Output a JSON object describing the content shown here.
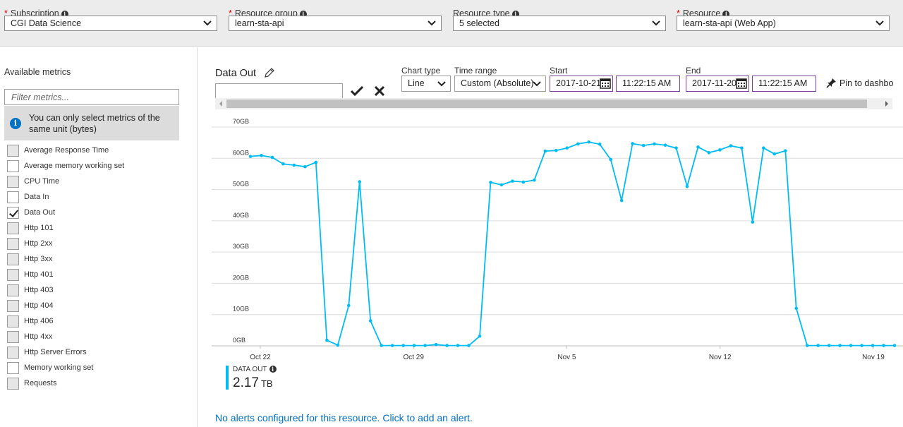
{
  "filters": {
    "subscription": {
      "label": "Subscription",
      "required": true,
      "value": "CGI Data Science"
    },
    "resource_group": {
      "label": "Resource group",
      "required": true,
      "value": "learn-sta-api"
    },
    "resource_type": {
      "label": "Resource type",
      "required": false,
      "value": "5 selected"
    },
    "resource": {
      "label": "Resource",
      "required": true,
      "value": "learn-sta-api (Web App)"
    }
  },
  "sidebar": {
    "title": "Available metrics",
    "filter_placeholder": "Filter metrics...",
    "note": "You can only select metrics of the same unit (bytes)",
    "metrics": [
      {
        "label": "Average Response Time",
        "checked": false,
        "enabled": false
      },
      {
        "label": "Average memory working set",
        "checked": false,
        "enabled": true
      },
      {
        "label": "CPU Time",
        "checked": false,
        "enabled": false
      },
      {
        "label": "Data In",
        "checked": false,
        "enabled": true
      },
      {
        "label": "Data Out",
        "checked": true,
        "enabled": true
      },
      {
        "label": "Http 101",
        "checked": false,
        "enabled": false
      },
      {
        "label": "Http 2xx",
        "checked": false,
        "enabled": false
      },
      {
        "label": "Http 3xx",
        "checked": false,
        "enabled": false
      },
      {
        "label": "Http 401",
        "checked": false,
        "enabled": false
      },
      {
        "label": "Http 403",
        "checked": false,
        "enabled": false
      },
      {
        "label": "Http 404",
        "checked": false,
        "enabled": false
      },
      {
        "label": "Http 406",
        "checked": false,
        "enabled": false
      },
      {
        "label": "Http 4xx",
        "checked": false,
        "enabled": false
      },
      {
        "label": "Http Server Errors",
        "checked": false,
        "enabled": false
      },
      {
        "label": "Memory working set",
        "checked": false,
        "enabled": true
      },
      {
        "label": "Requests",
        "checked": false,
        "enabled": false
      }
    ]
  },
  "chart_header": {
    "title": "Data Out",
    "chart_type_label": "Chart type",
    "chart_type_value": "Line",
    "time_range_label": "Time range",
    "time_range_value": "Custom (Absolute)",
    "start_label": "Start",
    "start_date": "2017-10-21",
    "start_time": "11:22:15 AM",
    "end_label": "End",
    "end_date": "2017-11-20",
    "end_time": "11:22:15 AM",
    "pin_label": "Pin to dashbo"
  },
  "summary": {
    "label": "DATA OUT",
    "value": "2.17",
    "unit": "TB"
  },
  "alert_text": "No alerts configured for this resource. Click to add an alert.",
  "colors": {
    "series": "#00bcf2",
    "link": "#0072c6",
    "required": "#e00000",
    "date_border": "#7a3e9e"
  },
  "chart_data": {
    "type": "line",
    "title": "",
    "xlabel": "",
    "ylabel": "",
    "ylim": [
      0,
      70
    ],
    "y_unit": "GB",
    "y_ticks": [
      "0GB",
      "10GB",
      "20GB",
      "30GB",
      "40GB",
      "50GB",
      "60GB",
      "70GB"
    ],
    "x_ticks": [
      "Oct 22",
      "Oct 29",
      "Nov 5",
      "Nov 12",
      "Nov 19"
    ],
    "grid": true,
    "series": [
      {
        "name": "Data Out",
        "values": [
          60.6,
          60.9,
          60.3,
          58.2,
          57.8,
          57.3,
          58.7,
          1.8,
          0.2,
          12.9,
          52.5,
          8.0,
          0.1,
          0.1,
          0.1,
          0.1,
          0.1,
          0.4,
          0.1,
          0.1,
          0.1,
          3.1,
          52.3,
          51.5,
          52.7,
          52.4,
          53.0,
          62.3,
          62.5,
          63.3,
          64.6,
          65.2,
          64.5,
          59.6,
          46.5,
          64.7,
          64.1,
          64.6,
          64.2,
          63.3,
          51.0,
          63.6,
          61.8,
          62.7,
          64.0,
          63.3,
          39.6,
          63.3,
          61.4,
          62.4,
          12.0,
          0.1,
          0.1,
          0.1,
          0.1,
          0.1,
          0.1,
          0.1,
          0.1,
          0.1
        ]
      }
    ]
  }
}
